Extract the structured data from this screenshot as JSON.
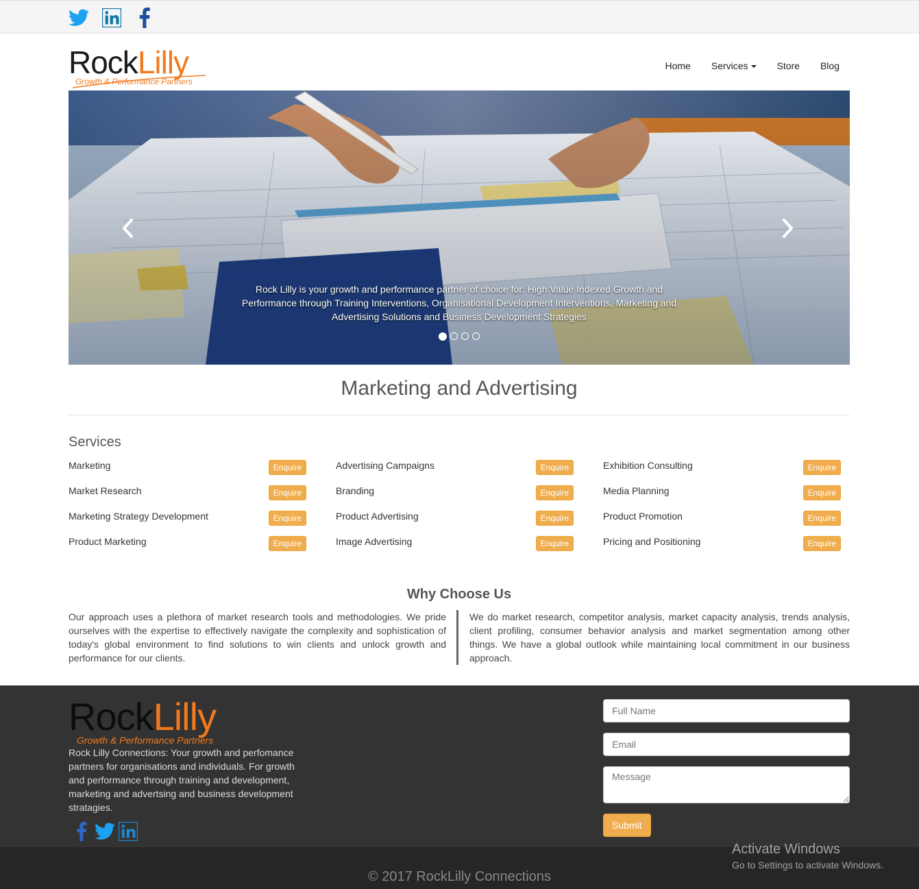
{
  "colors": {
    "accent": "#f27a1e",
    "enquire": "#f0ad4e",
    "footer_bg": "#333333",
    "twitter": "#1da1f2",
    "linkedin": "#0e76a8",
    "facebook": "#1f4e9c"
  },
  "topbar": {
    "icons": [
      "twitter-icon",
      "linkedin-icon",
      "facebook-icon"
    ]
  },
  "brand": {
    "rock": "Rock",
    "lilly": "Lilly",
    "tagline": "Growth & Performance Partners"
  },
  "nav": {
    "home": "Home",
    "services": "Services",
    "store": "Store",
    "blog": "Blog"
  },
  "carousel": {
    "caption": "Rock Lilly is your growth and performance partner of choice for: High Value Indexed Growth and Performance through Training Interventions, Organisational Development Interventions, Marketing and Advertising Solutions and Business Development Strategies",
    "slides": 4,
    "active_slide": 1
  },
  "main": {
    "title": "Marketing and Advertising",
    "services_heading": "Services",
    "enquire_label": "Enquire",
    "columns": [
      [
        "Marketing",
        "Market Research",
        "Marketing Strategy Development",
        "Product Marketing"
      ],
      [
        "Advertising Campaigns",
        "Branding",
        "Product Advertising",
        "Image Advertising"
      ],
      [
        "Exhibition Consulting",
        "Media Planning",
        "Product Promotion",
        "Pricing and Positioning"
      ]
    ],
    "why_heading": "Why Choose Us",
    "why_left": "Our approach uses a plethora of market research tools and methodologies. We pride ourselves with the expertise to effectively navigate the complexity and sophistication of today's global environment to find solutions to win clients and unlock growth and performance for our clients.",
    "why_right": "We do market research, competitor analysis, market capacity analysis, trends analysis, client profiling, consumer behavior analysis and market segmentation among other things. We have a global outlook while maintaining local commitment in our business approach."
  },
  "footer": {
    "description": "Rock Lilly Connections: Your growth and perfomance partners for organisations and individuals. For growth and performance through training and development, marketing and advertsing and business development stratagies.",
    "icons": [
      "facebook-icon",
      "twitter-icon",
      "linkedin-icon"
    ],
    "form": {
      "name_placeholder": "Full Name",
      "email_placeholder": "Email",
      "message_placeholder": "Message",
      "submit_label": "Submit"
    },
    "copyright": "© 2017 RockLilly Connections"
  },
  "watermark": {
    "title": "Activate Windows",
    "subtitle": "Go to Settings to activate Windows."
  }
}
